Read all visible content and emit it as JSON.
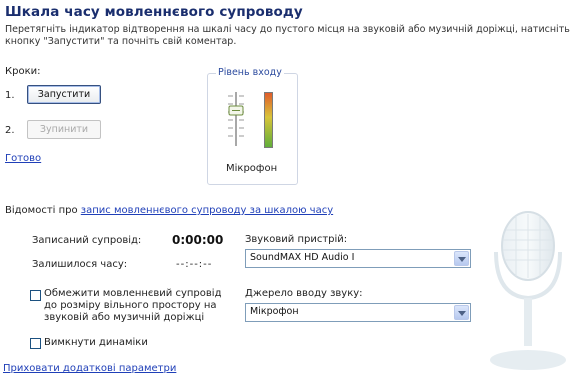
{
  "header": {
    "title": "Шкала часу мовленнєвого супроводу",
    "instructions": "Перетягніть індикатор відтворення на шкалі часу до пустого місця на звуковій або музичній доріжці, натисніть кнопку \"Запустити\" та почніть свій коментар."
  },
  "steps": {
    "label": "Кроки:",
    "step1_number": "1.",
    "start_button": "Запустити",
    "step2_number": "2.",
    "stop_button": "Зупинити",
    "done_link": "Готово"
  },
  "input_level": {
    "legend": "Рівень входу",
    "device_label": "Мікрофон"
  },
  "info": {
    "prefix": "Відомості про ",
    "link": "запис мовленнєвого супроводу за шкалою часу"
  },
  "recording": {
    "recorded_label": "Записаний супровід:",
    "recorded_value": "0:00:00",
    "remaining_label": "Залишилося часу:",
    "remaining_value": "--:--:--"
  },
  "device": {
    "label": "Звуковий пристрій:",
    "value": "SoundMAX HD Audio I"
  },
  "source": {
    "label": "Джерело вводу звуку:",
    "value": "Мікрофон"
  },
  "options": {
    "limit_label": "Обмежити мовленнєвий супровід до розміру вільного простору на звуковій або музичній доріжці",
    "mute_label": "Вимкнути динаміки"
  },
  "footer": {
    "hide_link": "Приховати додаткові параметри"
  },
  "colors": {
    "title": "#1a2e6e",
    "link": "#1f3fb8",
    "level_meter_top": "#e05a2a",
    "level_meter_bottom": "#5fae3a"
  }
}
